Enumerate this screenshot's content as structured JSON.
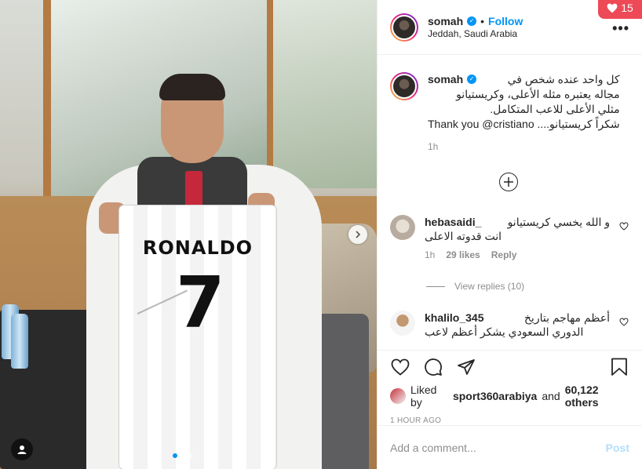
{
  "notification": {
    "count": "15",
    "icon": "heart-icon",
    "color": "#ed4956"
  },
  "header": {
    "username": "somah",
    "verified_icon": "verified-badge-icon",
    "separator": "•",
    "follow_label": "Follow",
    "location": "Jeddah, Saudi Arabia",
    "more_icon": "more-options-icon"
  },
  "media": {
    "jersey_name": "RONALDO",
    "jersey_number": "7",
    "carousel_dots": 3,
    "active_dot": 0
  },
  "caption": {
    "username": "somah",
    "lines": [
      "كل واحد عنده شخص في",
      "مجاله يعتبره مثله الأعلى، وكريستيانو",
      "مثلي الأعلى للاعب المتكامل.",
      "شكراً كريستيانو.... Thank you @cristiano"
    ],
    "time": "1h"
  },
  "comments": [
    {
      "username": "hebasaidi_",
      "lines": [
        "و الله يخسي كريستيانو",
        "انت قدوته الاعلى"
      ],
      "time": "1h",
      "likes": "29 likes",
      "reply_label": "Reply"
    },
    {
      "username": "khalilo_345",
      "lines": [
        "أعظم مهاجم بتاريخ",
        "الدوري السعودي يشكر أعظم لاعب"
      ],
      "time": "",
      "likes": "",
      "reply_label": ""
    }
  ],
  "view_replies": "View replies (10)",
  "actions": {
    "like_icon": "heart-outline-icon",
    "comment_icon": "comment-icon",
    "share_icon": "share-icon",
    "save_icon": "bookmark-icon"
  },
  "liked_by": {
    "prefix": "Liked by",
    "user": "sport360arabiya",
    "and": "and",
    "others": "60,122 others"
  },
  "timestamp": "1 HOUR AGO",
  "add_comment": {
    "placeholder": "Add a comment...",
    "post_label": "Post"
  },
  "colors": {
    "accent": "#0095f6",
    "text": "#262626",
    "muted": "#8e8e8e"
  }
}
